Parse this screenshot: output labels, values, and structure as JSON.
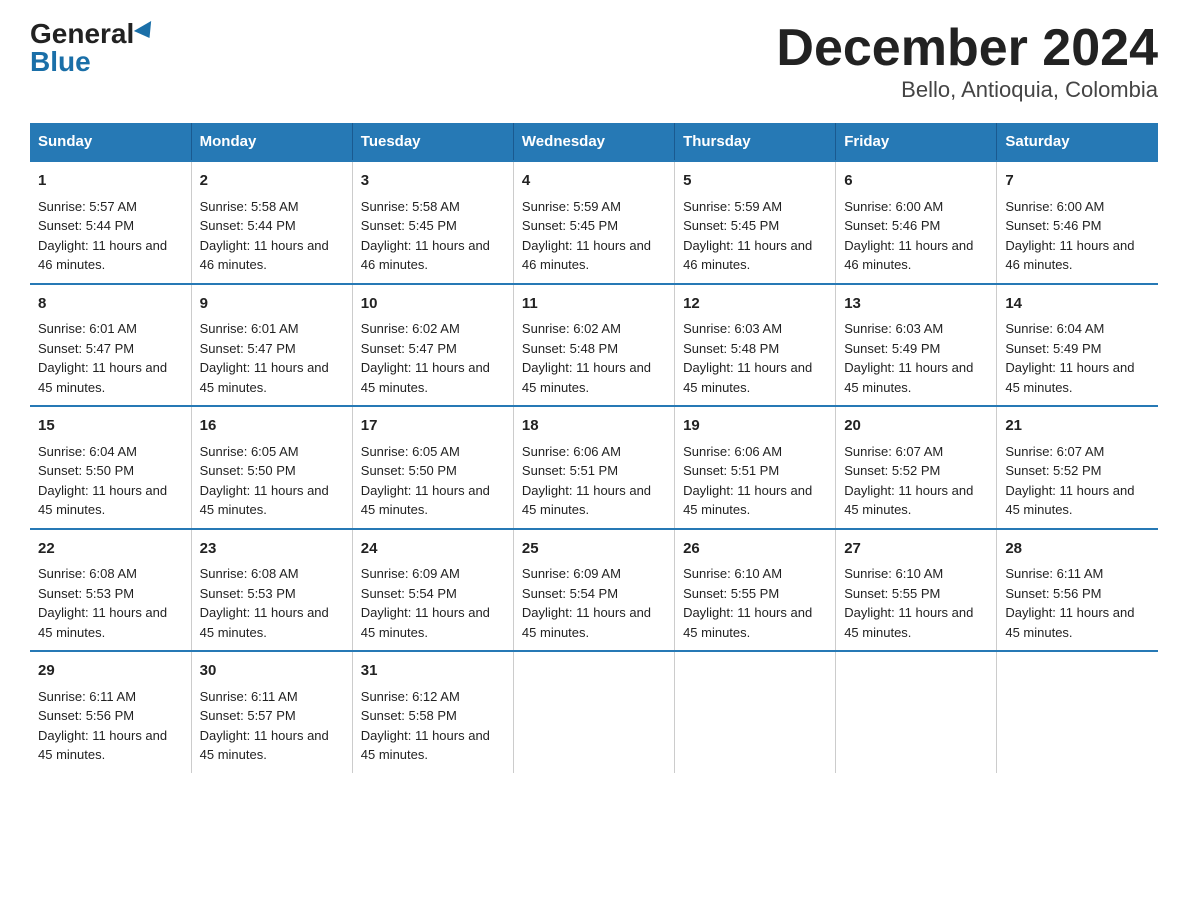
{
  "logo": {
    "general": "General",
    "blue": "Blue"
  },
  "title": "December 2024",
  "subtitle": "Bello, Antioquia, Colombia",
  "days_of_week": [
    "Sunday",
    "Monday",
    "Tuesday",
    "Wednesday",
    "Thursday",
    "Friday",
    "Saturday"
  ],
  "weeks": [
    [
      {
        "day": "1",
        "sunrise": "5:57 AM",
        "sunset": "5:44 PM",
        "daylight": "11 hours and 46 minutes."
      },
      {
        "day": "2",
        "sunrise": "5:58 AM",
        "sunset": "5:44 PM",
        "daylight": "11 hours and 46 minutes."
      },
      {
        "day": "3",
        "sunrise": "5:58 AM",
        "sunset": "5:45 PM",
        "daylight": "11 hours and 46 minutes."
      },
      {
        "day": "4",
        "sunrise": "5:59 AM",
        "sunset": "5:45 PM",
        "daylight": "11 hours and 46 minutes."
      },
      {
        "day": "5",
        "sunrise": "5:59 AM",
        "sunset": "5:45 PM",
        "daylight": "11 hours and 46 minutes."
      },
      {
        "day": "6",
        "sunrise": "6:00 AM",
        "sunset": "5:46 PM",
        "daylight": "11 hours and 46 minutes."
      },
      {
        "day": "7",
        "sunrise": "6:00 AM",
        "sunset": "5:46 PM",
        "daylight": "11 hours and 46 minutes."
      }
    ],
    [
      {
        "day": "8",
        "sunrise": "6:01 AM",
        "sunset": "5:47 PM",
        "daylight": "11 hours and 45 minutes."
      },
      {
        "day": "9",
        "sunrise": "6:01 AM",
        "sunset": "5:47 PM",
        "daylight": "11 hours and 45 minutes."
      },
      {
        "day": "10",
        "sunrise": "6:02 AM",
        "sunset": "5:47 PM",
        "daylight": "11 hours and 45 minutes."
      },
      {
        "day": "11",
        "sunrise": "6:02 AM",
        "sunset": "5:48 PM",
        "daylight": "11 hours and 45 minutes."
      },
      {
        "day": "12",
        "sunrise": "6:03 AM",
        "sunset": "5:48 PM",
        "daylight": "11 hours and 45 minutes."
      },
      {
        "day": "13",
        "sunrise": "6:03 AM",
        "sunset": "5:49 PM",
        "daylight": "11 hours and 45 minutes."
      },
      {
        "day": "14",
        "sunrise": "6:04 AM",
        "sunset": "5:49 PM",
        "daylight": "11 hours and 45 minutes."
      }
    ],
    [
      {
        "day": "15",
        "sunrise": "6:04 AM",
        "sunset": "5:50 PM",
        "daylight": "11 hours and 45 minutes."
      },
      {
        "day": "16",
        "sunrise": "6:05 AM",
        "sunset": "5:50 PM",
        "daylight": "11 hours and 45 minutes."
      },
      {
        "day": "17",
        "sunrise": "6:05 AM",
        "sunset": "5:50 PM",
        "daylight": "11 hours and 45 minutes."
      },
      {
        "day": "18",
        "sunrise": "6:06 AM",
        "sunset": "5:51 PM",
        "daylight": "11 hours and 45 minutes."
      },
      {
        "day": "19",
        "sunrise": "6:06 AM",
        "sunset": "5:51 PM",
        "daylight": "11 hours and 45 minutes."
      },
      {
        "day": "20",
        "sunrise": "6:07 AM",
        "sunset": "5:52 PM",
        "daylight": "11 hours and 45 minutes."
      },
      {
        "day": "21",
        "sunrise": "6:07 AM",
        "sunset": "5:52 PM",
        "daylight": "11 hours and 45 minutes."
      }
    ],
    [
      {
        "day": "22",
        "sunrise": "6:08 AM",
        "sunset": "5:53 PM",
        "daylight": "11 hours and 45 minutes."
      },
      {
        "day": "23",
        "sunrise": "6:08 AM",
        "sunset": "5:53 PM",
        "daylight": "11 hours and 45 minutes."
      },
      {
        "day": "24",
        "sunrise": "6:09 AM",
        "sunset": "5:54 PM",
        "daylight": "11 hours and 45 minutes."
      },
      {
        "day": "25",
        "sunrise": "6:09 AM",
        "sunset": "5:54 PM",
        "daylight": "11 hours and 45 minutes."
      },
      {
        "day": "26",
        "sunrise": "6:10 AM",
        "sunset": "5:55 PM",
        "daylight": "11 hours and 45 minutes."
      },
      {
        "day": "27",
        "sunrise": "6:10 AM",
        "sunset": "5:55 PM",
        "daylight": "11 hours and 45 minutes."
      },
      {
        "day": "28",
        "sunrise": "6:11 AM",
        "sunset": "5:56 PM",
        "daylight": "11 hours and 45 minutes."
      }
    ],
    [
      {
        "day": "29",
        "sunrise": "6:11 AM",
        "sunset": "5:56 PM",
        "daylight": "11 hours and 45 minutes."
      },
      {
        "day": "30",
        "sunrise": "6:11 AM",
        "sunset": "5:57 PM",
        "daylight": "11 hours and 45 minutes."
      },
      {
        "day": "31",
        "sunrise": "6:12 AM",
        "sunset": "5:58 PM",
        "daylight": "11 hours and 45 minutes."
      },
      {
        "day": "",
        "sunrise": "",
        "sunset": "",
        "daylight": ""
      },
      {
        "day": "",
        "sunrise": "",
        "sunset": "",
        "daylight": ""
      },
      {
        "day": "",
        "sunrise": "",
        "sunset": "",
        "daylight": ""
      },
      {
        "day": "",
        "sunrise": "",
        "sunset": "",
        "daylight": ""
      }
    ]
  ],
  "label_sunrise": "Sunrise:",
  "label_sunset": "Sunset:",
  "label_daylight": "Daylight:"
}
